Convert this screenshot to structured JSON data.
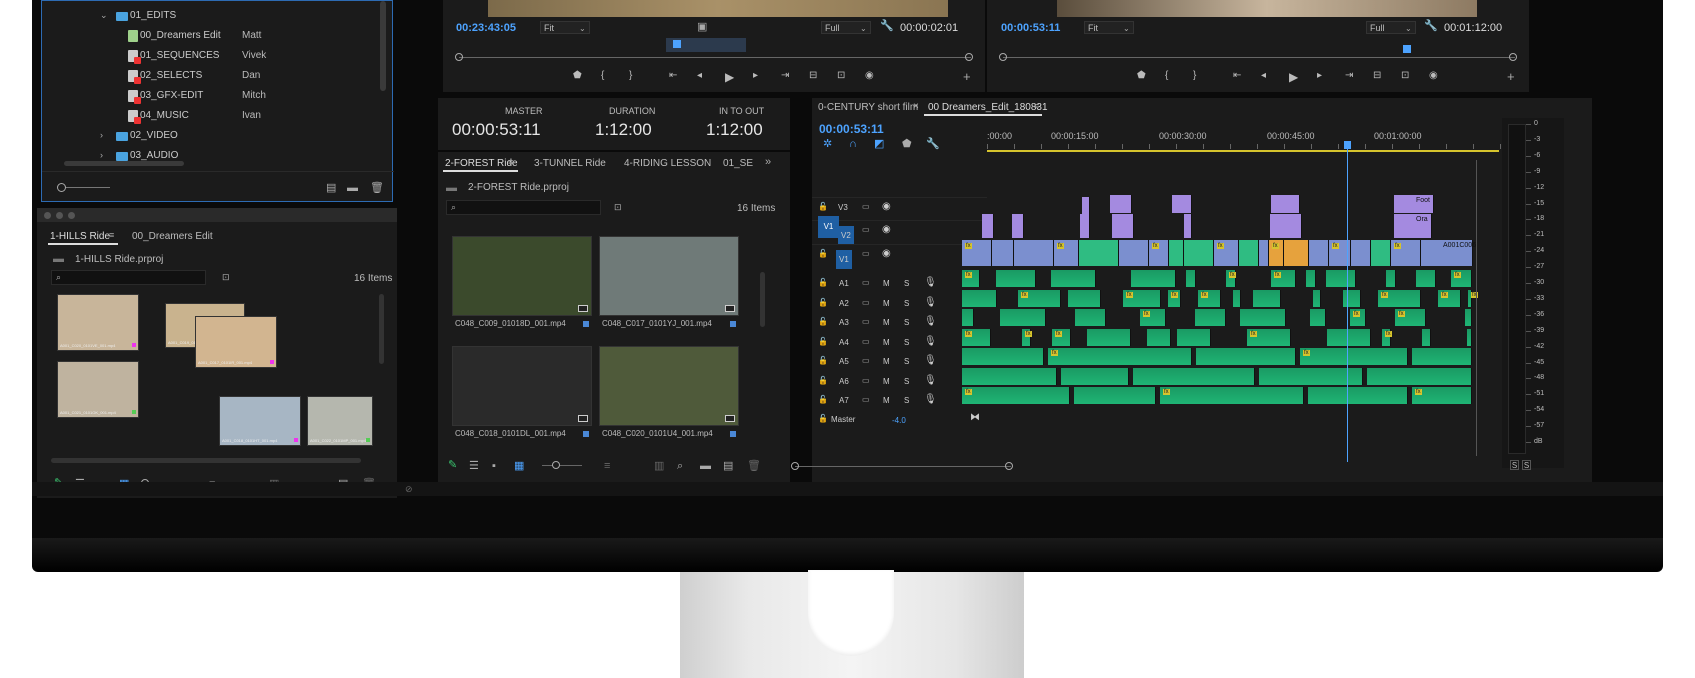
{
  "project_tree": {
    "items": [
      {
        "name": "01_EDITS",
        "owner": ""
      },
      {
        "name": "00_Dreamers Edit",
        "owner": "Matt"
      },
      {
        "name": "01_SEQUENCES",
        "owner": "Vivek"
      },
      {
        "name": "02_SELECTS",
        "owner": "Dan"
      },
      {
        "name": "03_GFX-EDIT",
        "owner": "Mitch"
      },
      {
        "name": "04_MUSIC",
        "owner": "Ivan"
      },
      {
        "name": "02_VIDEO",
        "owner": ""
      },
      {
        "name": "03_AUDIO",
        "owner": ""
      }
    ]
  },
  "hills_panel": {
    "tabs": [
      {
        "label": "1-HILLS Ride"
      },
      {
        "label": "00_Dreamers Edit"
      }
    ],
    "project_name": "1-HILLS Ride.prproj",
    "item_count": "16 Items",
    "thumbs": [
      {
        "label": "A001_C020_0101VE_001.mp4",
        "color": "#c8b59a"
      },
      {
        "label": "A001_C019_0101...",
        "color": "#c9b38e"
      },
      {
        "label": "A001_C017_0101IR_001.mp4",
        "color": "#d2b590"
      },
      {
        "label": "A001_C021_0101OK_001.mp4",
        "color": "#bfb39f"
      },
      {
        "label": "A001_C018_0101HT_001.mp4",
        "color": "#a7b6c4"
      },
      {
        "label": "A001_C022_0101MP_001.mp4",
        "color": "#b5b7ae"
      }
    ]
  },
  "source_monitor": {
    "timecode": "00:23:43:05",
    "fit": "Fit",
    "quality": "Full",
    "duration": "00:00:02:01"
  },
  "program_monitor": {
    "timecode": "00:00:53:11",
    "fit": "Fit",
    "quality": "Full",
    "duration": "00:01:12:00"
  },
  "info": {
    "master_label": "MASTER",
    "master": "00:00:53:11",
    "duration_label": "DURATION",
    "duration": "1:12:00",
    "inout_label": "IN TO OUT",
    "inout": "1:12:00"
  },
  "forest_panel": {
    "tabs": [
      {
        "label": "2-FOREST Ride"
      },
      {
        "label": "3-TUNNEL Ride"
      },
      {
        "label": "4-RIDING LESSON"
      },
      {
        "label": "01_SE"
      }
    ],
    "project_name": "2-FOREST Ride.prproj",
    "item_count": "16 Items",
    "clips": [
      {
        "label": "C048_C009_01018D_001.mp4",
        "color": "#3b4a2c"
      },
      {
        "label": "C048_C017_0101YJ_001.mp4",
        "color": "#6f7a78"
      },
      {
        "label": "C048_C018_0101DL_001.mp4",
        "color": "#2a2a2a"
      },
      {
        "label": "C048_C020_0101U4_001.mp4",
        "color": "#4f5a3a"
      }
    ]
  },
  "timeline": {
    "tabs": [
      {
        "label": "0-CENTURY short film"
      },
      {
        "label": "00 Dreamers_Edit_180831"
      }
    ],
    "close_glyph": "×",
    "timecode": "00:00:53:11",
    "ruler": [
      ":00:00",
      "00:00:15:00",
      "00:00:30:00",
      "00:00:45:00",
      "00:01:00:00"
    ],
    "video_tracks": [
      {
        "name": "V3"
      },
      {
        "name": "V2"
      },
      {
        "name": "V1"
      }
    ],
    "audio_tracks": [
      {
        "name": "A1"
      },
      {
        "name": "A2"
      },
      {
        "name": "A3"
      },
      {
        "name": "A4"
      },
      {
        "name": "A5"
      },
      {
        "name": "A6"
      },
      {
        "name": "A7"
      }
    ],
    "master_label": "Master",
    "master_value": "-4.0",
    "v1_source": "V1",
    "mute_label": "M",
    "solo_label": "S",
    "clip_labels": {
      "foot": "Foot",
      "ora": "Ora",
      "v1_clip": "A001C006",
      "fx": "fx"
    }
  },
  "meter": {
    "scale": [
      "0",
      "-3",
      "-6",
      "-9",
      "-12",
      "-15",
      "-18",
      "-21",
      "-24",
      "-27",
      "-30",
      "-33",
      "-36",
      "-39",
      "-42",
      "-45",
      "-48",
      "-51",
      "-54",
      "-57",
      "dB"
    ],
    "solo_buttons": [
      "S",
      "S"
    ]
  },
  "colors": {
    "accent": "#4da3ff",
    "video_clip": "#7b8fcf",
    "purple": "#a48ae0",
    "audio": "#21a86b",
    "yellow": "#d6c42d"
  }
}
